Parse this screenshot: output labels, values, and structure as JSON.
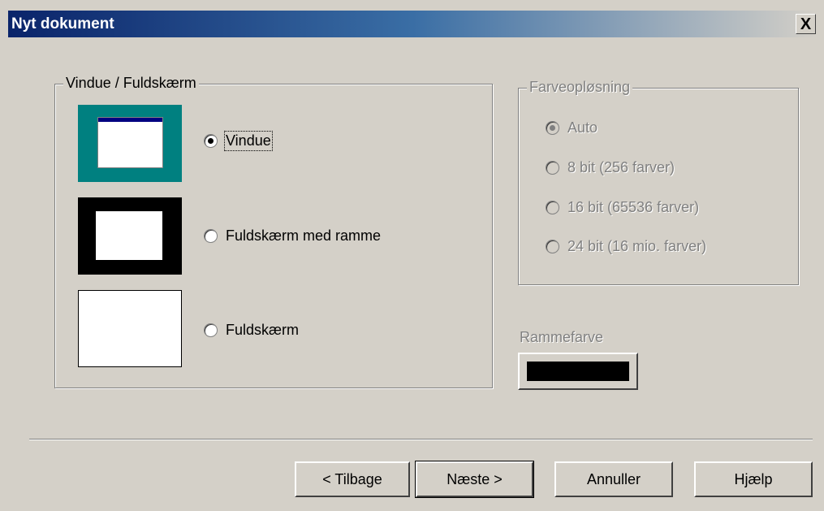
{
  "dialog": {
    "title": "Nyt dokument",
    "close_label": "X"
  },
  "mode_group": {
    "label": "Vindue / Fuldskærm",
    "options": [
      {
        "label": "Vindue",
        "checked": true
      },
      {
        "label": "Fuldskærm med ramme",
        "checked": false
      },
      {
        "label": "Fuldskærm",
        "checked": false
      }
    ],
    "thumbnail_colors": {
      "window_desktop": "#008080",
      "window_titlebar": "#000080",
      "frame_border": "#000000"
    }
  },
  "color_group": {
    "label": "Farveopløsning",
    "disabled": true,
    "options": [
      {
        "label": "Auto",
        "checked": true
      },
      {
        "label": "8 bit (256 farver)",
        "checked": false
      },
      {
        "label": "16 bit (65536 farver)",
        "checked": false
      },
      {
        "label": "24 bit (16 mio. farver)",
        "checked": false
      }
    ]
  },
  "frame_color": {
    "label": "Rammefarve",
    "value": "#000000"
  },
  "buttons": {
    "back": "< Tilbage",
    "next": "Næste >",
    "cancel": "Annuller",
    "help": "Hjælp"
  }
}
